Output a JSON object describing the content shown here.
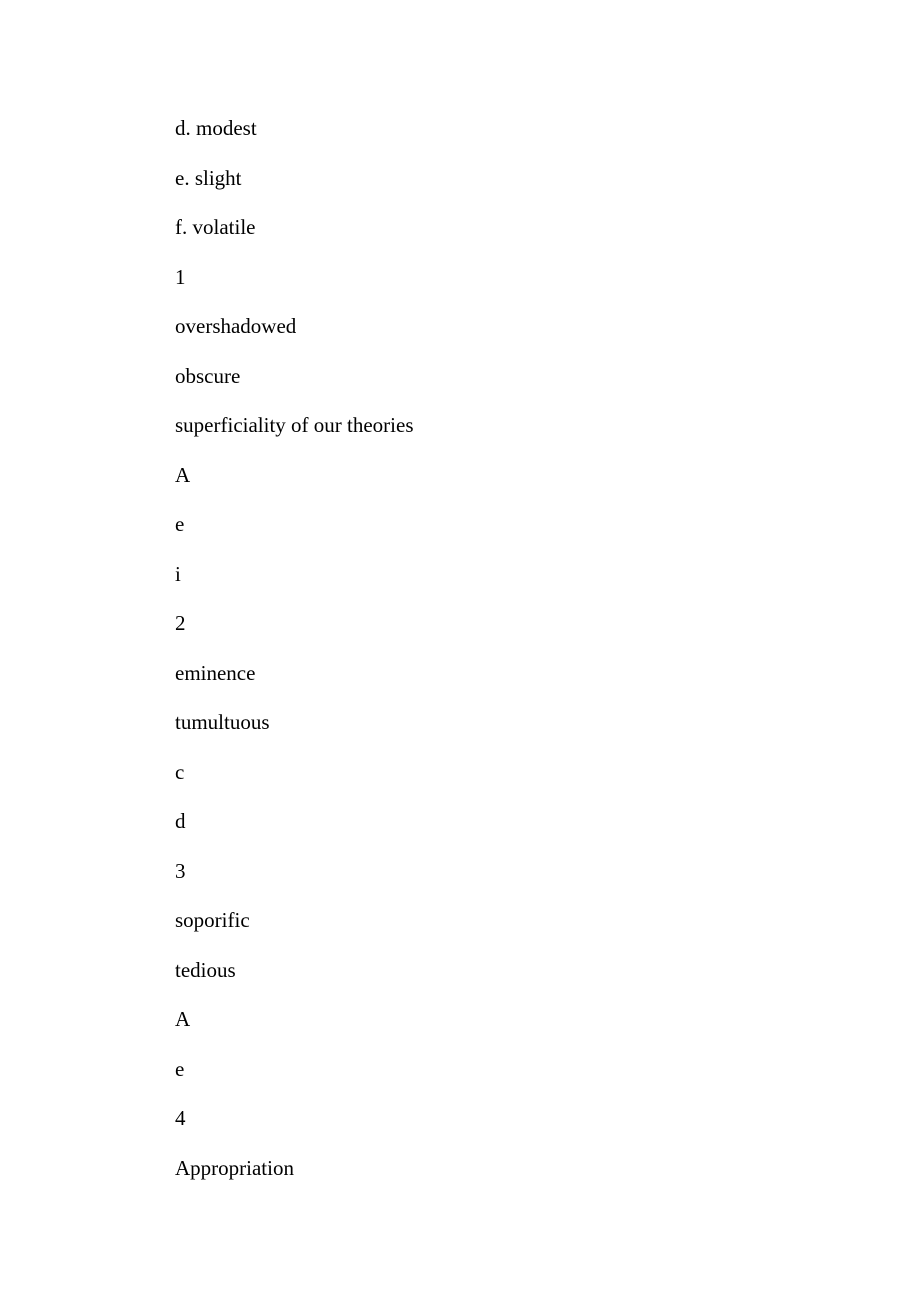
{
  "lines": [
    "d. modest",
    "e. slight",
    "f. volatile",
    "1",
    "overshadowed",
    "obscure",
    "superficiality of our theories",
    "A",
    "e",
    "i",
    "2",
    "eminence",
    "tumultuous",
    "c",
    "d",
    "3",
    "soporific",
    "tedious",
    "A",
    "e",
    "4",
    "Appropriation"
  ]
}
